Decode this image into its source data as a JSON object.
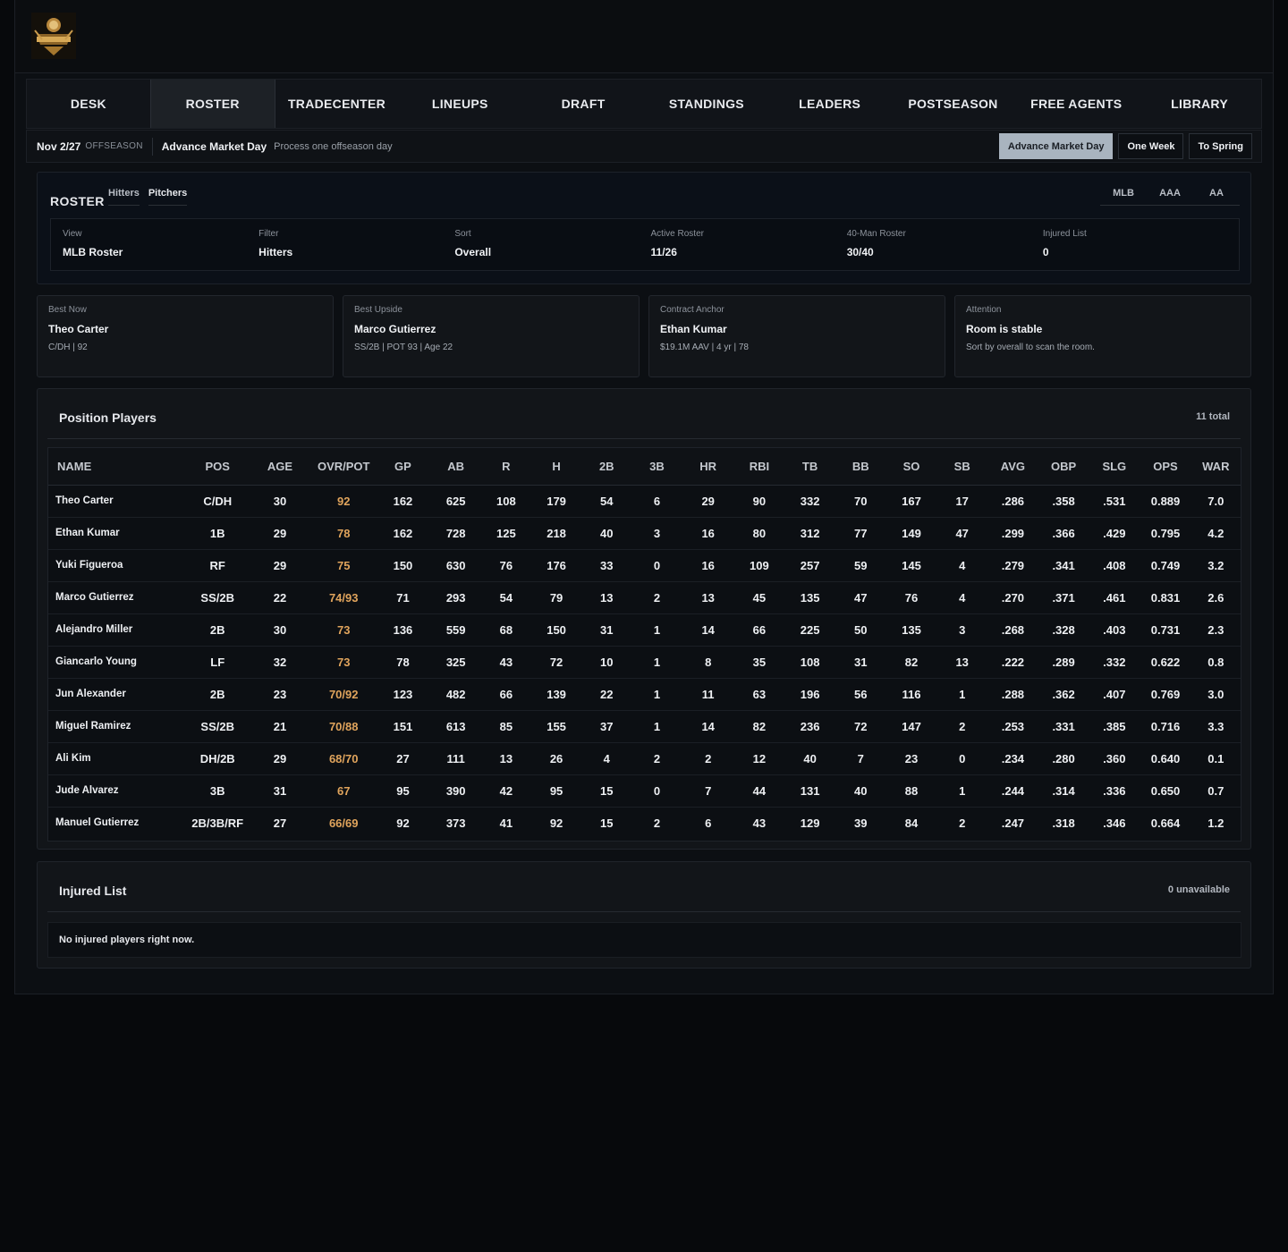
{
  "nav": {
    "items": [
      "DESK",
      "ROSTER",
      "TRADECENTER",
      "LINEUPS",
      "DRAFT",
      "STANDINGS",
      "LEADERS",
      "POSTSEASON",
      "FREE AGENTS",
      "LIBRARY"
    ],
    "active": "ROSTER"
  },
  "daybar": {
    "date": "Nov 2/27",
    "phase": "OFFSEASON",
    "advance_title": "Advance Market Day",
    "advance_sub": "Process one offseason day",
    "btn_advance": "Advance Market Day",
    "btn_week": "One Week",
    "btn_spring": "To Spring"
  },
  "roster": {
    "title": "ROSTER",
    "tab_hitters": "Hitters",
    "tab_pitchers": "Pitchers",
    "levels": [
      "MLB",
      "AAA",
      "AA"
    ],
    "stats": [
      {
        "label": "View",
        "value": "MLB Roster"
      },
      {
        "label": "Filter",
        "value": "Hitters"
      },
      {
        "label": "Sort",
        "value": "Overall"
      },
      {
        "label": "Active Roster",
        "value": "11/26"
      },
      {
        "label": "40-Man Roster",
        "value": "30/40"
      },
      {
        "label": "Injured List",
        "value": "0"
      }
    ]
  },
  "cards": [
    {
      "label": "Best Now",
      "name": "Theo Carter",
      "sub": "C/DH | 92"
    },
    {
      "label": "Best Upside",
      "name": "Marco Gutierrez",
      "sub": "SS/2B | POT 93 | Age 22"
    },
    {
      "label": "Contract Anchor",
      "name": "Ethan Kumar",
      "sub": "$19.1M AAV | 4 yr | 78"
    },
    {
      "label": "Attention",
      "name": "Room is stable",
      "sub": "Sort by overall to scan the room."
    }
  ],
  "position_players": {
    "title": "Position Players",
    "count": "11 total",
    "columns": [
      "NAME",
      "POS",
      "AGE",
      "OVR/POT",
      "GP",
      "AB",
      "R",
      "H",
      "2B",
      "3B",
      "HR",
      "RBI",
      "TB",
      "BB",
      "SO",
      "SB",
      "AVG",
      "OBP",
      "SLG",
      "OPS",
      "WAR"
    ],
    "rows": [
      [
        "Theo Carter",
        "C/DH",
        "30",
        "92",
        "162",
        "625",
        "108",
        "179",
        "54",
        "6",
        "29",
        "90",
        "332",
        "70",
        "167",
        "17",
        ".286",
        ".358",
        ".531",
        "0.889",
        "7.0"
      ],
      [
        "Ethan Kumar",
        "1B",
        "29",
        "78",
        "162",
        "728",
        "125",
        "218",
        "40",
        "3",
        "16",
        "80",
        "312",
        "77",
        "149",
        "47",
        ".299",
        ".366",
        ".429",
        "0.795",
        "4.2"
      ],
      [
        "Yuki Figueroa",
        "RF",
        "29",
        "75",
        "150",
        "630",
        "76",
        "176",
        "33",
        "0",
        "16",
        "109",
        "257",
        "59",
        "145",
        "4",
        ".279",
        ".341",
        ".408",
        "0.749",
        "3.2"
      ],
      [
        "Marco Gutierrez",
        "SS/2B",
        "22",
        "74/93",
        "71",
        "293",
        "54",
        "79",
        "13",
        "2",
        "13",
        "45",
        "135",
        "47",
        "76",
        "4",
        ".270",
        ".371",
        ".461",
        "0.831",
        "2.6"
      ],
      [
        "Alejandro Miller",
        "2B",
        "30",
        "73",
        "136",
        "559",
        "68",
        "150",
        "31",
        "1",
        "14",
        "66",
        "225",
        "50",
        "135",
        "3",
        ".268",
        ".328",
        ".403",
        "0.731",
        "2.3"
      ],
      [
        "Giancarlo Young",
        "LF",
        "32",
        "73",
        "78",
        "325",
        "43",
        "72",
        "10",
        "1",
        "8",
        "35",
        "108",
        "31",
        "82",
        "13",
        ".222",
        ".289",
        ".332",
        "0.622",
        "0.8"
      ],
      [
        "Jun Alexander",
        "2B",
        "23",
        "70/92",
        "123",
        "482",
        "66",
        "139",
        "22",
        "1",
        "11",
        "63",
        "196",
        "56",
        "116",
        "1",
        ".288",
        ".362",
        ".407",
        "0.769",
        "3.0"
      ],
      [
        "Miguel Ramirez",
        "SS/2B",
        "21",
        "70/88",
        "151",
        "613",
        "85",
        "155",
        "37",
        "1",
        "14",
        "82",
        "236",
        "72",
        "147",
        "2",
        ".253",
        ".331",
        ".385",
        "0.716",
        "3.3"
      ],
      [
        "Ali Kim",
        "DH/2B",
        "29",
        "68/70",
        "27",
        "111",
        "13",
        "26",
        "4",
        "2",
        "2",
        "12",
        "40",
        "7",
        "23",
        "0",
        ".234",
        ".280",
        ".360",
        "0.640",
        "0.1"
      ],
      [
        "Jude Alvarez",
        "3B",
        "31",
        "67",
        "95",
        "390",
        "42",
        "95",
        "15",
        "0",
        "7",
        "44",
        "131",
        "40",
        "88",
        "1",
        ".244",
        ".314",
        ".336",
        "0.650",
        "0.7"
      ],
      [
        "Manuel Gutierrez",
        "2B/3B/RF",
        "27",
        "66/69",
        "92",
        "373",
        "41",
        "92",
        "15",
        "2",
        "6",
        "43",
        "129",
        "39",
        "84",
        "2",
        ".247",
        ".318",
        ".346",
        "0.664",
        "1.2"
      ]
    ]
  },
  "injured": {
    "title": "Injured List",
    "count": "0 unavailable",
    "empty": "No injured players right now."
  },
  "colors": {
    "accent": "#e0a45c",
    "primary_button": "#a9b4bf"
  }
}
